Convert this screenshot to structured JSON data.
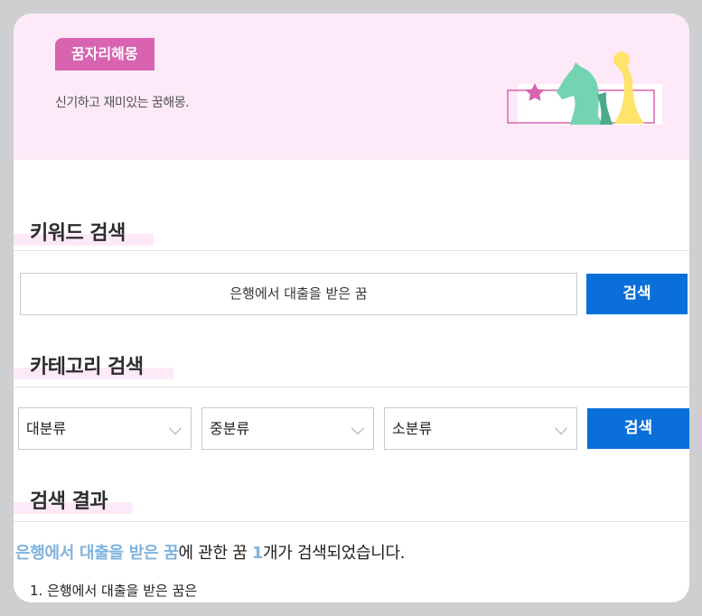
{
  "brand": {
    "badge": "꿈자리해몽",
    "tagline": "신기하고 재미있는 꿈해몽."
  },
  "keyword_section": {
    "title": "키워드 검색",
    "input_value": "은행에서 대출을 받은 꿈",
    "search_label": "검색"
  },
  "category_section": {
    "title": "카테고리 검색",
    "selects": [
      "대분류",
      "중분류",
      "소분류"
    ],
    "search_label": "검색"
  },
  "results_section": {
    "title": "검색 결과",
    "query": "은행에서 대출을 받은 꿈",
    "text_mid": "에 관한 꿈 ",
    "count": "1",
    "text_end": "개가 검색되었습니다.",
    "items": [
      "1. 은행에서 대출을 받은 꿈은"
    ]
  },
  "colors": {
    "accent": "#0a6fd9",
    "brand": "#d863b0",
    "hero_bg": "#fde9f7"
  },
  "icons": [
    "chess-knight-illustration",
    "star-icon",
    "chevron-down-icon"
  ]
}
